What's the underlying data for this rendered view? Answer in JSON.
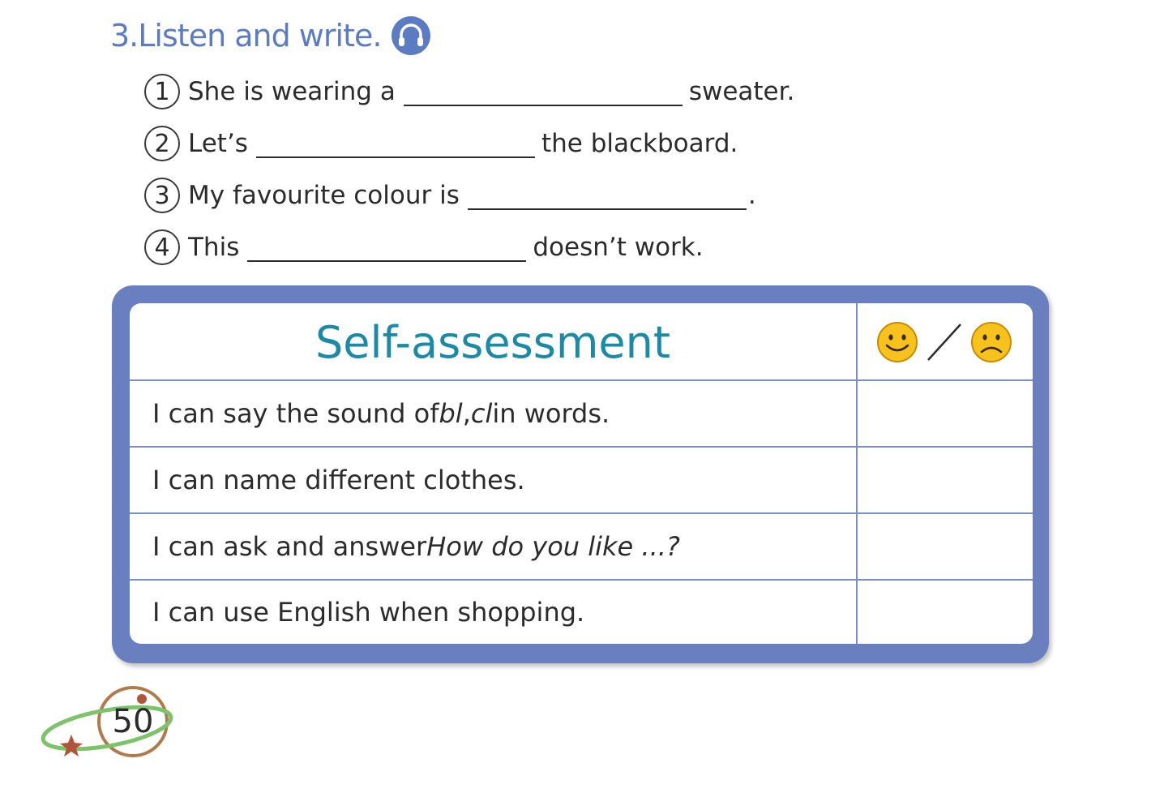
{
  "exercise": {
    "number_label": "3.",
    "title": "Listen and write.",
    "icon": "headphones-icon",
    "items": [
      {
        "num": "1",
        "before": "She is wearing a",
        "after": "sweater."
      },
      {
        "num": "2",
        "before": "Let’s",
        "after": "the blackboard."
      },
      {
        "num": "3",
        "before": "My favourite colour is",
        "after": "."
      },
      {
        "num": "4",
        "before": "This",
        "after": "doesn’t work."
      }
    ]
  },
  "self_assessment": {
    "title": "Self-assessment",
    "rating_icons": [
      "happy-face-icon",
      "sad-face-icon"
    ],
    "rows": [
      {
        "pre": "I can say the sound of ",
        "i1": "bl",
        "mid": ", ",
        "i2": "cl",
        "post": " in words."
      },
      {
        "pre": "I can name different clothes.",
        "i1": "",
        "mid": "",
        "i2": "",
        "post": ""
      },
      {
        "pre": "I can ask and answer ",
        "i1": "How do you like ...?",
        "mid": "",
        "i2": "",
        "post": ""
      },
      {
        "pre": "I can use English when shopping.",
        "i1": "",
        "mid": "",
        "i2": "",
        "post": ""
      }
    ]
  },
  "page": {
    "number": "50"
  },
  "colors": {
    "heading": "#5b7cc2",
    "panel": "#6a7fc0",
    "title": "#1a8aa6",
    "face": "#f7c21b"
  }
}
